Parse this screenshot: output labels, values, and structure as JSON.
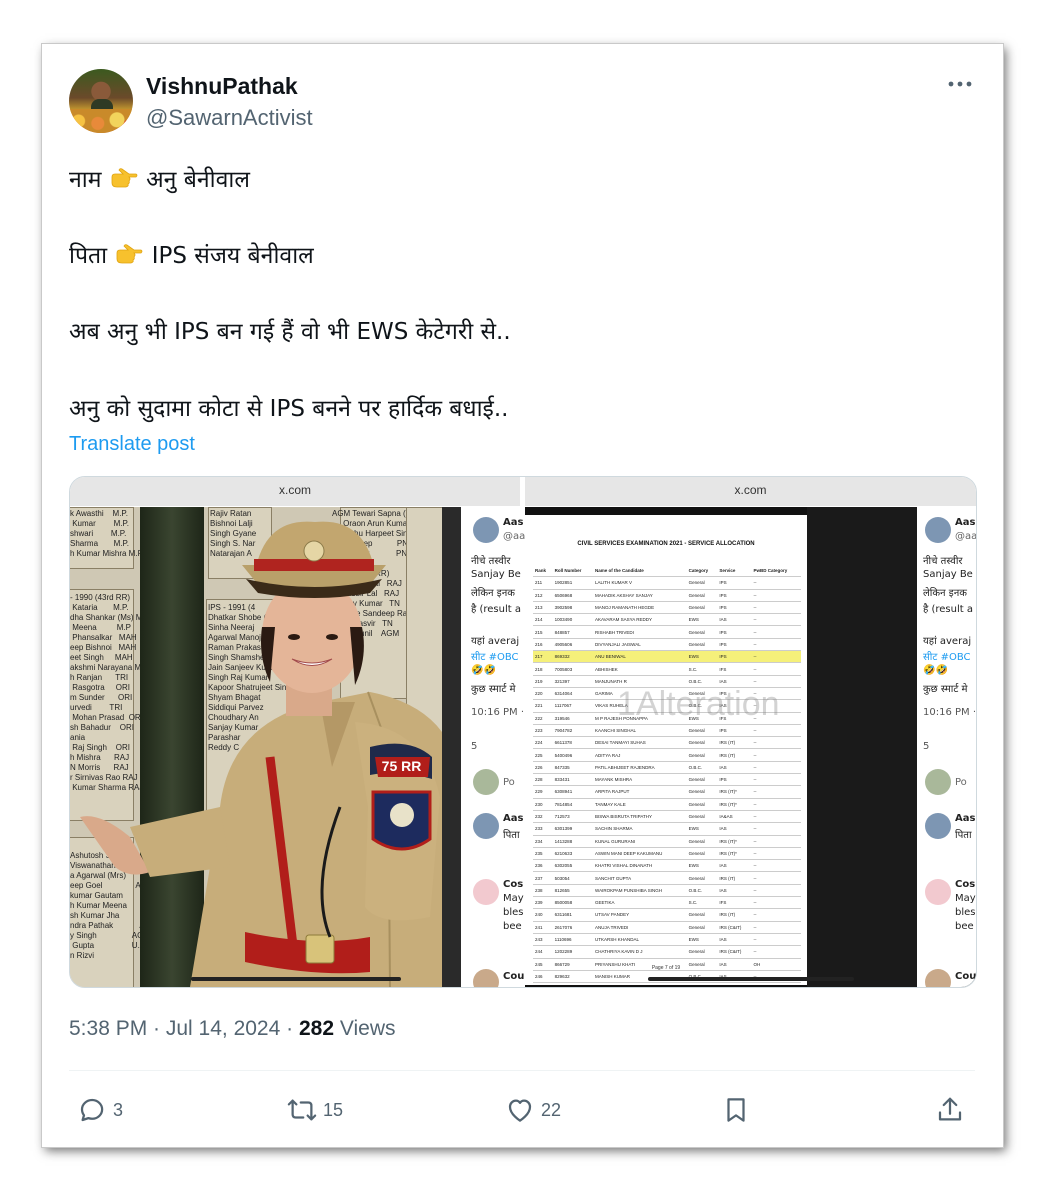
{
  "user": {
    "display_name": "VishnuPathak",
    "handle": "@SawarnActivist"
  },
  "post": {
    "lines": [
      {
        "before": "नाम",
        "emoji": "pointing-right",
        "after": "अनु बेनीवाल"
      },
      {
        "before": "पिता",
        "emoji": "pointing-right",
        "after": "IPS संजय बेनीवाल"
      },
      {
        "before": "अब अनु भी IPS बन गई हैं वो भी EWS केटेगरी से..",
        "emoji": null,
        "after": ""
      },
      {
        "before": "अनु को सुदामा कोटा से IPS बनने पर हार्दिक बधाई..",
        "emoji": null,
        "after": ""
      }
    ],
    "translate_label": "Translate post"
  },
  "media": {
    "left_bar": "x.com",
    "right_bar": "x.com",
    "left_board_text_1": "k Awasthi    M.P.\n Kumar        M.P.\nshwari        M.P.\nSharma       M.P.\nh Kumar Mishra M.P",
    "left_board_text_2": "- 1990 (43rd RR)\n Kataria       M.P.\ndha Shankar (Ms) M.P\n Meena         M.P\n Phansalkar   MAH\neep Bishnoi   MAH\neet Singh     MAH\nakshmi Narayana MAH\nh Ranjan      TRI\n Rasgotra     ORI\nm Sunder      ORI\nurvedi        TRI\n Mohan Prasad  ORI\nsh Bahadur    ORI\nania\n Raj Singh    ORI\nh Mishra      RAJ\nN Morris      RAJ\nr Sirnivas Rao RAJ\n Kumar Sharma RAJ",
    "left_board_text_3": "Ashutosh Sinha        T.N.\nViswanathan            T.N.\na Agarwal (Mrs)        T.N.\neep Goel               AGM\nkumar Gautam           AGM\nh Kumar Meena          AGM\nsh Kumar Jha           AGM\nndra Pathak            AGM\ny Singh                AGM\n Gupta                 U.P.\nn Rizvi",
    "left_board_text_4": "Rajiv Ratan\nBishnoi Lalji\nSingh Gyane\nSingh S. Nar\nNatarajan A",
    "left_board_text_5": "IPS - 1991 (4\nDhatkar Shobe (Ms)\nSinha Neeraj\nAgarwal Manoj\nRaman Prakash\nSingh Shamsher\nJain Sanjeev Kumar   HAR\nSingh Raj Kumar\nKapoor Shatrujeet Singh HAR\nShyam Bhagat\nSiddiqui Parvez\nChoudhary An\nSanjay Kumar\nParashar\nReddy C",
    "left_board_text_6": "AGM Tewari Sapna (Ms)\n     Oraon Arun Kumar   PNB\n     Vishu Harpeet Singh PNB\n     Kuldeep           PNB\n     Gaurav            PNB\n\n-1992 (45th RR)\nThangkhanlal   RAJ\nRaghubir Lal   RAJ\nRajeev Kumar   TN\nRathore Sandeep Rai TN\nSingh Jasvir   TN\nSingh Sunil    AGM",
    "uniform_badge": "75 RR",
    "doc_title": "CIVIL SERVICES EXAMINATION 2021 - SERVICE ALLOCATION",
    "doc_headers": [
      "Rank",
      "Roll Number",
      "Name of the Candidate",
      "Category",
      "Service",
      "PwBD Category"
    ],
    "doc_rows": [
      [
        "211",
        "1902851",
        "LALITH KUMAR V",
        "General",
        "IPS",
        "--"
      ],
      [
        "212",
        "6506968",
        "MAHADIK AKSHAY SANJAY",
        "General",
        "IPS",
        "--"
      ],
      [
        "213",
        "3902598",
        "MANOJ RAMANATH HEGDE",
        "General",
        "IPS",
        "--"
      ],
      [
        "214",
        "1003490",
        "AKAVARAM SASYA REDDY",
        "EWS",
        "IAS",
        "--"
      ],
      [
        "215",
        "848857",
        "RISHABH TRIVEDI",
        "General",
        "IPS",
        "--"
      ],
      [
        "216",
        "4905606",
        "DIVYANJALI JAISWAL",
        "General",
        "IPS",
        "--"
      ],
      [
        "217",
        "869332",
        "ANU BENIWAL",
        "EWS",
        "IPS",
        "--"
      ],
      [
        "218",
        "7005803",
        "ABHISHEK",
        "S.C.",
        "IFS",
        "--"
      ],
      [
        "219",
        "321397",
        "MANJUNATH R",
        "O.B.C.",
        "IAS",
        "--"
      ],
      [
        "220",
        "6314064",
        "GARIMA",
        "General",
        "IPS",
        "--"
      ],
      [
        "221",
        "1117067",
        "VIKAS RUHELA",
        "O.B.C.",
        "IAS",
        "--"
      ],
      [
        "222",
        "319546",
        "M P RAJESH PONNAPPA",
        "EWS",
        "IFS",
        "--"
      ],
      [
        "223",
        "7904782",
        "KAANCHI SINGHAL",
        "General",
        "IPS",
        "--"
      ],
      [
        "224",
        "6611378",
        "DESAI TANMAYI SUHAS",
        "General",
        "IRS (IT)",
        "--"
      ],
      [
        "225",
        "5400496",
        "ADITYA RAJ",
        "General",
        "IRS (IT)",
        "--"
      ],
      [
        "226",
        "847335",
        "PATIL ABHIJEET RAJENDRA",
        "O.B.C.",
        "IAS",
        "--"
      ],
      [
        "228",
        "833431",
        "MAYANK MISHRA",
        "General",
        "IPS",
        "--"
      ],
      [
        "229",
        "6308941",
        "ARPITA RAJPUT",
        "General",
        "IRS (IT)*",
        "--"
      ],
      [
        "230",
        "7814854",
        "TANMAY KALE",
        "General",
        "IRS (IT)*",
        "--"
      ],
      [
        "232",
        "712573",
        "BISWA BISRUTA TRIPATHY",
        "General",
        "IA&AS",
        "--"
      ],
      [
        "233",
        "6301399",
        "SACHIN SHARMA",
        "EWS",
        "IAS",
        "--"
      ],
      [
        "234",
        "1413288",
        "KUNAL GURURANI",
        "General",
        "IRS (IT)*",
        "--"
      ],
      [
        "235",
        "6210633",
        "ASWIN MANI DEEP KAKUMANU",
        "General",
        "IRS (IT)*",
        "--"
      ],
      [
        "236",
        "6302055",
        "KHATRI VISHAL DINANATH",
        "EWS",
        "IAS",
        "--"
      ],
      [
        "237",
        "503054",
        "SANCHIT GUPTA",
        "General",
        "IRS (IT)",
        "--"
      ],
      [
        "238",
        "812655",
        "WAIROKPAM PUNSHIBA SINGH",
        "O.B.C.",
        "IAS",
        "--"
      ],
      [
        "239",
        "8500058",
        "GEETIKA",
        "S.C.",
        "IFS",
        "--"
      ],
      [
        "240",
        "6311681",
        "UTSAV PANDEY",
        "General",
        "IRS (IT)",
        "--"
      ],
      [
        "241",
        "2617076",
        "ANUJA TRIVEDI",
        "General",
        "IRS (C&IT)",
        "--"
      ],
      [
        "243",
        "1110696",
        "UTKARSH KHANDAL",
        "EWS",
        "IAS",
        "--"
      ],
      [
        "244",
        "1202289",
        "CHATHRIYA KAVIN D J",
        "General",
        "IRS (C&IT)",
        "--"
      ],
      [
        "245",
        "866729",
        "PRIYANSHU KHATI",
        "General",
        "IAS",
        "OH"
      ],
      [
        "246",
        "829632",
        "MANISH KUMAR",
        "O.B.C.",
        "IAS",
        "--"
      ]
    ],
    "doc_page": "Page 7 of 19",
    "watermark": "1Alteration",
    "side": {
      "name": "Aas",
      "handle": "@aa",
      "l1": "नीचे तस्वीर",
      "l2": "Sanjay Be",
      "l3": "लेकिन इनक",
      "l4": "है (result a",
      "l5": "यहां averaj",
      "l6": "सीट #OBC",
      "l7": "🤣🤣",
      "l8": "कुछ स्मार्ट मे",
      "time": "10:16 PM ·",
      "replies": "5",
      "reply_name": "Po",
      "c1_name": "Aas",
      "c1_text": "पिता",
      "c2_name": "Cos",
      "c2_l1": "May",
      "c2_l2": "bles",
      "c2_l3": "bee",
      "c3_name": "Cou"
    }
  },
  "meta": {
    "time": "5:38 PM · Jul 14, 2024 · ",
    "views_count": "282",
    "views_label": " Views"
  },
  "actions": {
    "replies": "3",
    "reposts": "15",
    "likes": "22"
  }
}
